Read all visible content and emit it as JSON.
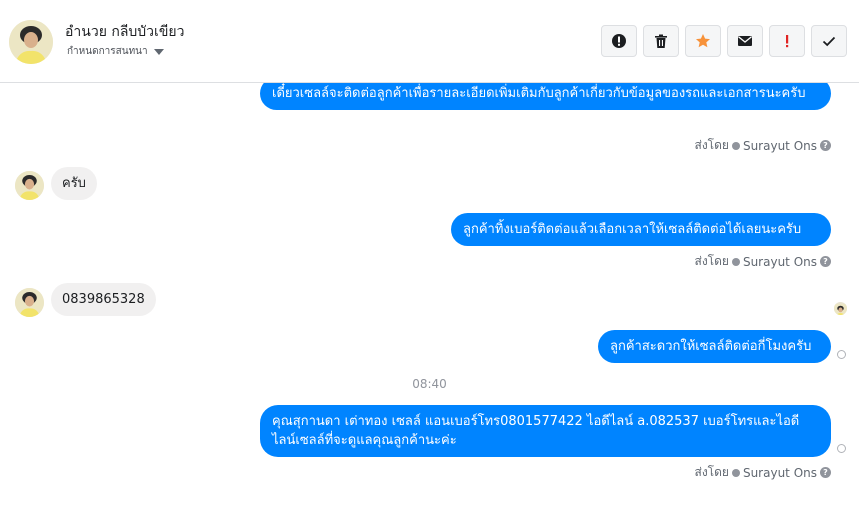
{
  "header": {
    "contact_name": "อำนวย กลีบบัวเขียว",
    "assign_label": "กำหนดการสนทนา",
    "toolbar": {
      "spam": "spam-icon",
      "delete": "trash-icon",
      "star": "star-icon",
      "email": "envelope-icon",
      "follow_up": "exclamation-icon",
      "done": "check-icon"
    }
  },
  "messages": [
    {
      "direction": "outgoing",
      "text": "เดี๋ยวเซลล์จะติดต่อลูกค้าเพื่อรายละเอียดเพิ่มเติมกับลูกค้าเกี่ยวกับข้อมูลของรถและเอกสารนะครับ",
      "sent_by_prefix": "ส่งโดย",
      "sender": "Surayut Ons"
    },
    {
      "direction": "incoming",
      "text": "ครับ"
    },
    {
      "direction": "outgoing",
      "text": "ลูกค้าทิ้งเบอร์ติดต่อแล้วเลือกเวลาให้เซลล์ติดต่อได้เลยนะครับ",
      "sent_by_prefix": "ส่งโดย",
      "sender": "Surayut Ons"
    },
    {
      "direction": "incoming",
      "text": "0839865328"
    },
    {
      "direction": "outgoing",
      "text": "ลูกค้าสะดวกให้เซลล์ติดต่อกี่โมงครับ"
    },
    {
      "type": "timestamp",
      "text": "08:40"
    },
    {
      "direction": "outgoing",
      "text": "คุณสุกานดา เต่าทอง  เซลล์ แอนเบอร์โทร0801577422 ไอดีไลน์ a.082537  เบอร์โทรและไอดีไลน์เซลล์ที่จะดูแลคุณลูกค้านะค่ะ",
      "sent_by_prefix": "ส่งโดย",
      "sender": "Surayut Ons"
    }
  ],
  "colors": {
    "outgoing_bubble": "#0084ff",
    "incoming_bubble": "#f1f0f0",
    "star_icon": "#f7923a",
    "exclamation_icon": "#e02424"
  }
}
